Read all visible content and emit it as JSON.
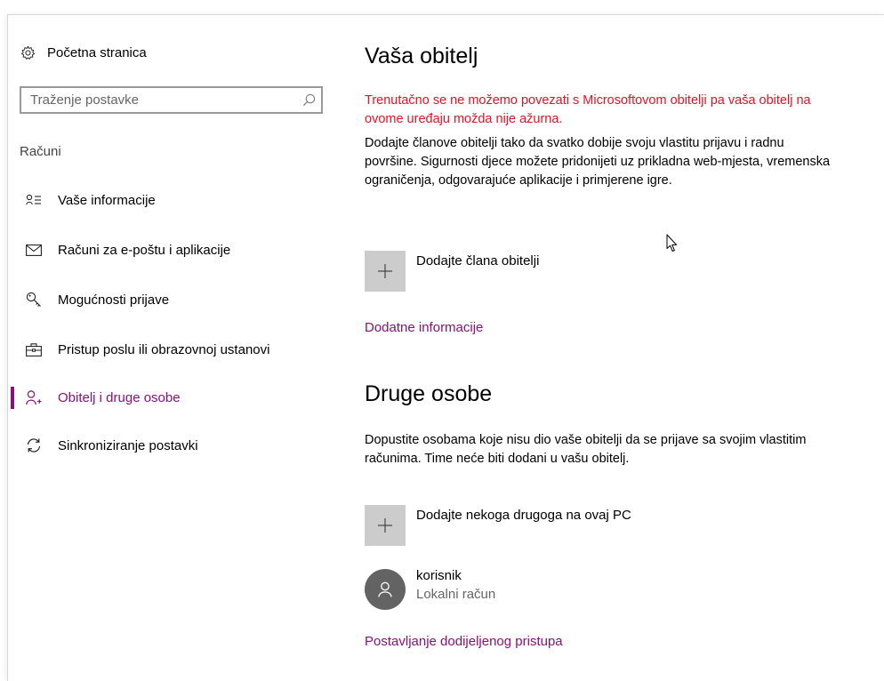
{
  "sidebar": {
    "home_label": "Početna stranica",
    "search_placeholder": "Traženje postavke",
    "section_label": "Računi",
    "items": [
      {
        "label": "Vaše informacije",
        "icon": "person-card-icon"
      },
      {
        "label": "Računi za e-poštu i aplikacije",
        "icon": "envelope-icon"
      },
      {
        "label": "Mogućnosti prijave",
        "icon": "key-icon"
      },
      {
        "label": "Pristup poslu ili obrazovnoj ustanovi",
        "icon": "briefcase-icon"
      },
      {
        "label": "Obitelj i druge osobe",
        "icon": "add-person-icon",
        "active": true
      },
      {
        "label": "Sinkroniziranje postavki",
        "icon": "sync-icon"
      }
    ]
  },
  "main": {
    "family": {
      "title": "Vaša obitelj",
      "error": "Trenutačno se ne možemo povezati s Microsoftovom obitelji pa vaša obitelj na ovome uređaju možda nije ažurna.",
      "description": "Dodajte članove obitelji tako da svatko dobije svoju vlastitu prijavu i radnu površine. Sigurnosti djece možete pridonijeti uz prikladna web-mjesta, vremenska ograničenja, odgovarajuće aplikacije i primjerene igre.",
      "add_label": "Dodajte člana obitelji",
      "more_info": "Dodatne informacije"
    },
    "others": {
      "title": "Druge osobe",
      "description": "Dopustite osobama koje nisu dio vaše obitelji da se prijave sa svojim vlastitim računima. Time neće biti dodani u vašu obitelj.",
      "add_label": "Dodajte nekoga drugoga na ovaj PC",
      "user_name": "korisnik",
      "user_type": "Lokalni račun",
      "assigned_access": "Postavljanje dodijeljenog pristupa"
    }
  },
  "colors": {
    "accent": "#86117c",
    "error": "#e81123",
    "tile": "#cccccc",
    "avatar": "#636363"
  }
}
